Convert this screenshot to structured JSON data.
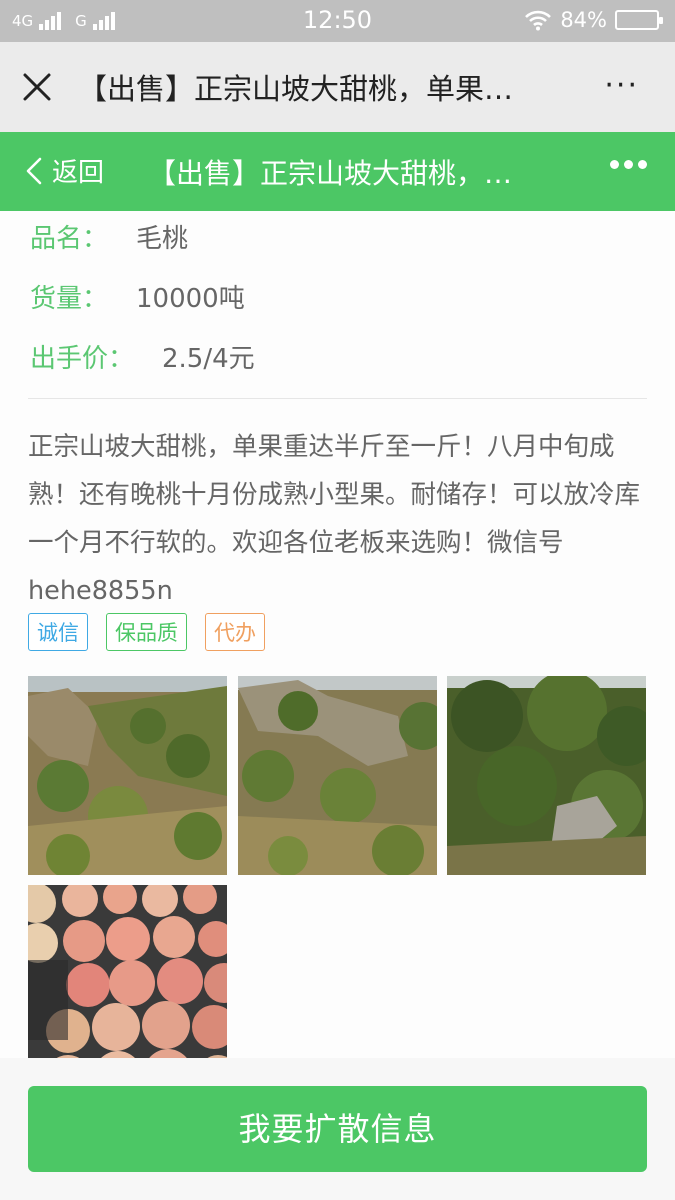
{
  "status_bar": {
    "network_left": "4G",
    "network_right": "G",
    "time": "12:50",
    "battery_text": "84%",
    "battery_level": 0.84
  },
  "wechat_bar": {
    "title": "【出售】正宗山坡大甜桃，单果…",
    "more": "···"
  },
  "page_header": {
    "back_label": "返回",
    "title": "【出售】正宗山坡大甜桃，…"
  },
  "fields": [
    {
      "label": "品名：",
      "value": "毛桃"
    },
    {
      "label": "货量：",
      "value": "10000吨"
    },
    {
      "label": "出手价：",
      "value": "2.5/4元"
    }
  ],
  "description": "正宗山坡大甜桃，单果重达半斤至一斤！八月中旬成熟！还有晚桃十月份成熟小型果。耐储存！可以放冷库一个月不行软的。欢迎各位老板来选购！微信号hehe8855n",
  "tags": [
    {
      "text": "诚信",
      "color": "#3fa9e4"
    },
    {
      "text": "保品质",
      "color": "#4cc765"
    },
    {
      "text": "代办",
      "color": "#f0a060"
    }
  ],
  "photos": [
    "photo-hillside-orchard",
    "photo-hillside-rocks",
    "photo-peach-trees",
    "photo-peach-crate"
  ],
  "action": {
    "button_label": "我要扩散信息"
  },
  "colors": {
    "accent": "#4cc765",
    "label_green": "#5bc772"
  }
}
